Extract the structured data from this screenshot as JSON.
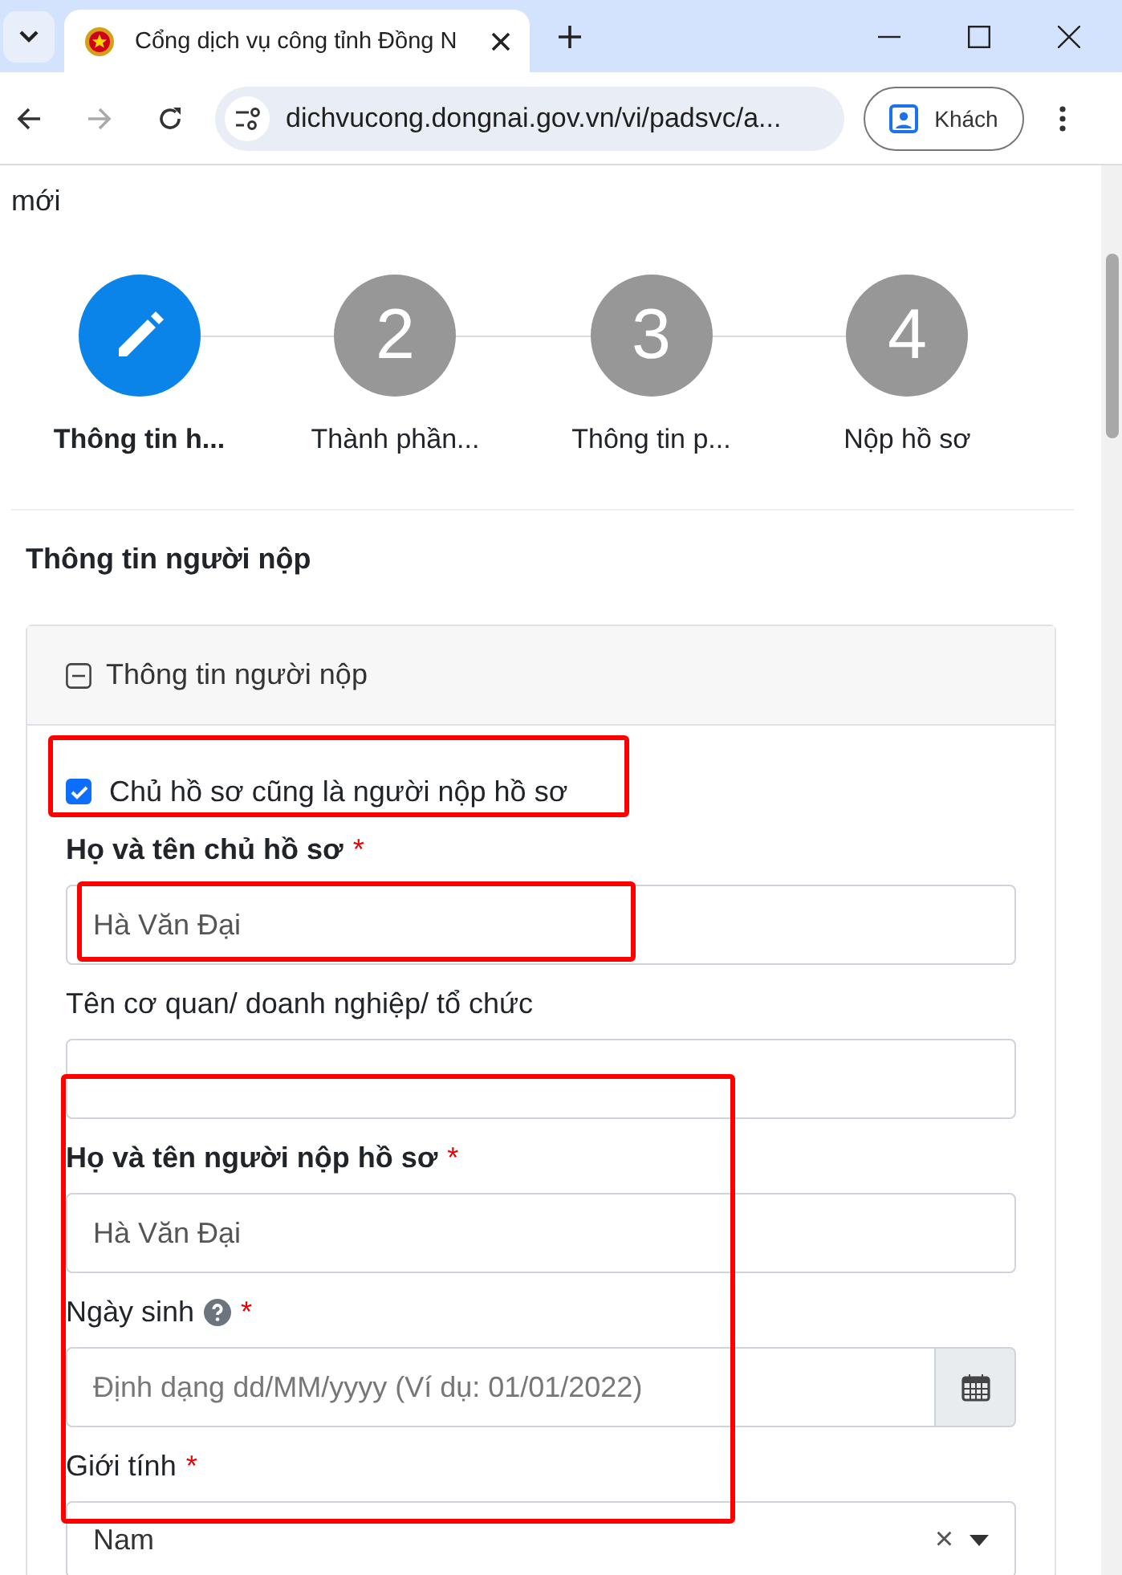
{
  "browser": {
    "tabs": [
      {
        "title": "Cổng dịch vụ công tỉnh Đồng N",
        "selected": true
      }
    ],
    "url": "dichvucong.dongnai.gov.vn/vi/padsvc/a...",
    "profile": "Khách"
  },
  "page": {
    "title_fragment": "mới",
    "steps": [
      {
        "label": "Thông tin h...",
        "selected": true
      },
      {
        "number": "2",
        "label": "Thành phần...",
        "selected": false
      },
      {
        "number": "3",
        "label": "Thông tin p...",
        "selected": false
      },
      {
        "number": "4",
        "label": "Nộp hồ sơ",
        "selected": false
      }
    ],
    "section_title": "Thông tin người nộp",
    "panel": {
      "title": "Thông tin người nộp",
      "expanded": true,
      "checkbox": {
        "label": "Chủ hồ sơ cũng là người nộp hồ sơ",
        "checked": true
      },
      "fields": [
        {
          "kind": "text",
          "label": "Họ và tên chủ hồ sơ",
          "bold": true,
          "required": "*",
          "value": "Hà Văn Đại"
        },
        {
          "kind": "text",
          "label": "Tên cơ quan/ doanh nghiệp/ tổ chức",
          "bold": false
        },
        {
          "kind": "text",
          "label": "Họ và tên người nộp hồ sơ",
          "bold": true,
          "required": "*",
          "value": "Hà Văn Đại"
        },
        {
          "kind": "date",
          "label": "Ngày sinh",
          "bold": false,
          "help": true,
          "required": "*",
          "placeholder": "Định dạng dd/MM/yyyy (Ví dụ: 01/01/2022)"
        },
        {
          "kind": "select",
          "label": "Giới tính",
          "bold": false,
          "required": "*",
          "value": "Nam",
          "clear": "×"
        }
      ]
    }
  }
}
